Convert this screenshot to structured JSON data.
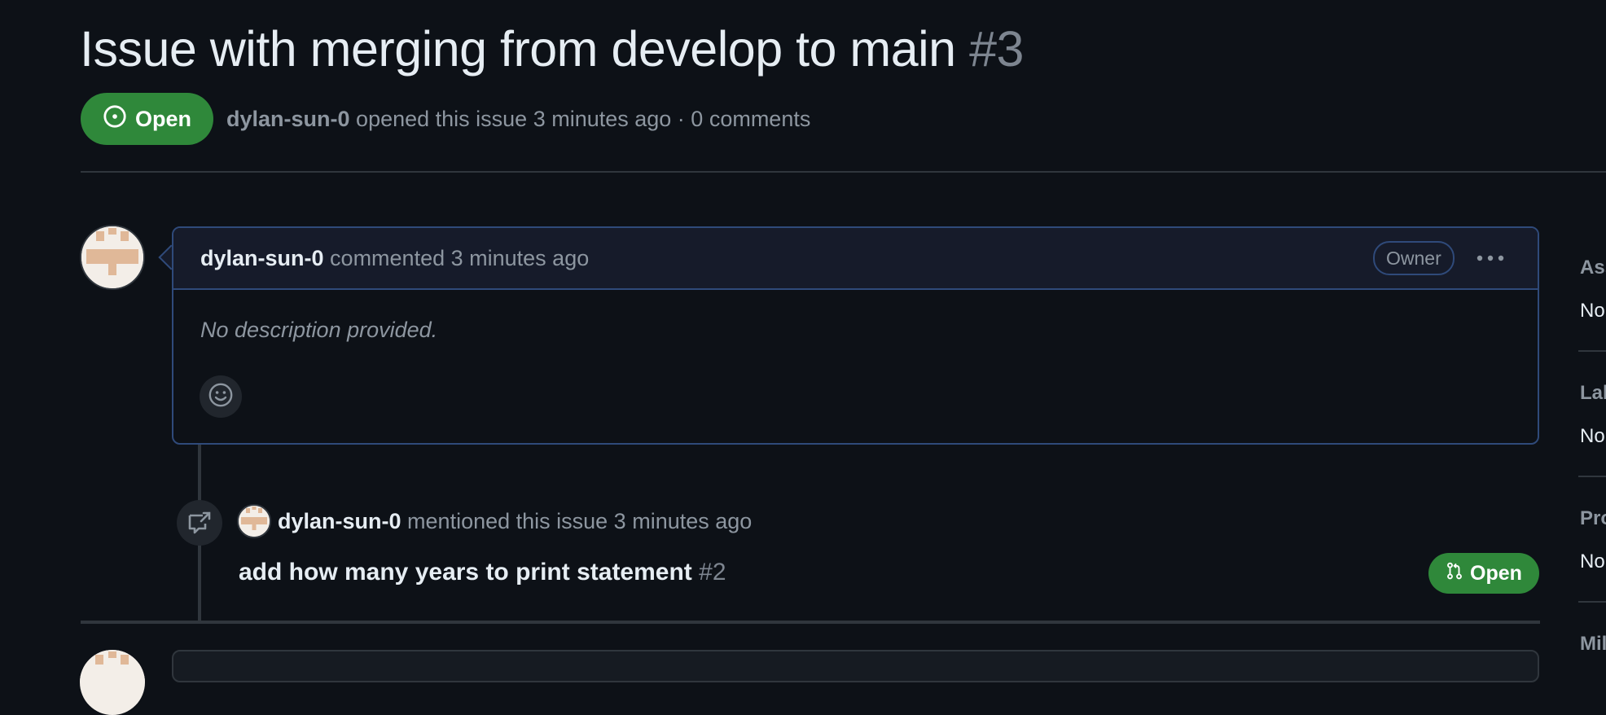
{
  "issue": {
    "title": "Issue with merging from develop to main",
    "number": "#3",
    "state": "Open",
    "author": "dylan-sun-0",
    "opened_text": "opened this issue 3 minutes ago · 0 comments"
  },
  "comment": {
    "author": "dylan-sun-0",
    "action": "commented 3 minutes ago",
    "role_badge": "Owner",
    "body": "No description provided."
  },
  "mention_event": {
    "actor": "dylan-sun-0",
    "action": "mentioned this issue 3 minutes ago",
    "ref_title": "add how many years to print statement",
    "ref_number": "#2",
    "ref_state": "Open"
  },
  "sidebar": {
    "sections": [
      {
        "label": "Ass",
        "value": "No"
      },
      {
        "label": "Lab",
        "value": "No"
      },
      {
        "label": "Pro",
        "value": "No"
      },
      {
        "label": "Mil",
        "value": ""
      }
    ]
  },
  "colors": {
    "background": "#0d1117",
    "open_green": "#2f883a",
    "comment_border": "#2f4a7a",
    "muted_text": "#8d96a0"
  }
}
